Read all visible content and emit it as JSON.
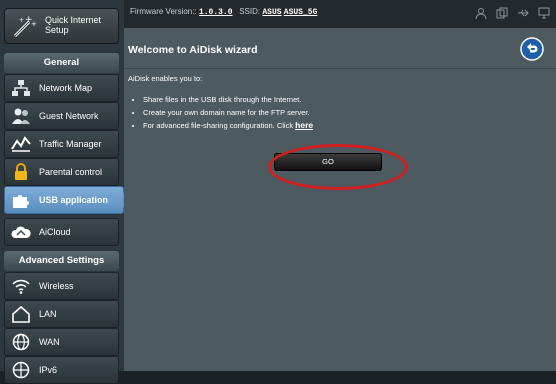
{
  "topbar": {
    "firmware_label": "Firmware Version::",
    "firmware_value": "1.0.3.0",
    "ssid_label": "SSID:",
    "ssid_1": "ASUS",
    "ssid_2": "ASUS_5G",
    "icons": [
      "user-icon",
      "copy-icon",
      "usb-icon",
      "monitor-icon"
    ]
  },
  "sidebar": {
    "quick_setup": "Quick Internet Setup",
    "general_header": "General",
    "items": [
      {
        "label": "Network Map",
        "icon": "network-map-icon"
      },
      {
        "label": "Guest Network",
        "icon": "guest-network-icon"
      },
      {
        "label": "Traffic Manager",
        "icon": "traffic-manager-icon"
      },
      {
        "label": "Parental control",
        "icon": "parental-control-icon"
      },
      {
        "label": "USB application",
        "icon": "usb-puzzle-icon",
        "active": true
      },
      {
        "label": "AiCloud",
        "icon": "cloud-icon"
      }
    ],
    "advanced_header": "Advanced Settings",
    "advanced_items": [
      {
        "label": "Wireless",
        "icon": "wireless-icon"
      },
      {
        "label": "LAN",
        "icon": "home-icon"
      },
      {
        "label": "WAN",
        "icon": "globe-icon"
      },
      {
        "label": "IPv6",
        "icon": "ipv6-icon"
      }
    ]
  },
  "main": {
    "title": "Welcome to AiDisk wizard",
    "intro": "AiDisk enables you to:",
    "bullets": [
      "Share files in the USB disk through the Internet.",
      "Create your own domain name for the FTP server.",
      "For advanced file-sharing configuration. Click"
    ],
    "link_text": "here",
    "go_label": "GO"
  },
  "colors": {
    "highlight_circle": "#d21f1f",
    "active_nav": "#6a9dcf"
  }
}
